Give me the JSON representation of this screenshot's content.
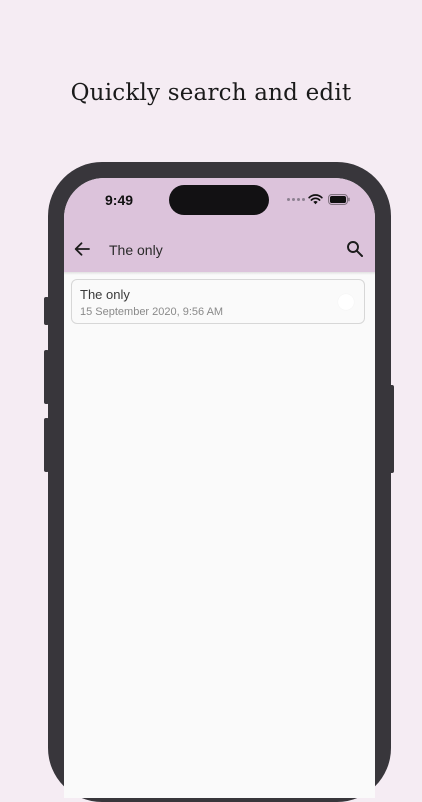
{
  "headline": "Quickly search and edit",
  "status_bar": {
    "time": "9:49"
  },
  "app_bar": {
    "title": "The only",
    "back_icon": "arrow-back-icon",
    "search_icon": "search-icon",
    "background": "#DCC3DB"
  },
  "notes": [
    {
      "title": "The only",
      "date": "15 September 2020, 9:56 AM"
    }
  ],
  "colors": {
    "page_background": "#F5ECF3",
    "phone_frame": "#38363B",
    "screen_background": "#FAFAFA"
  }
}
